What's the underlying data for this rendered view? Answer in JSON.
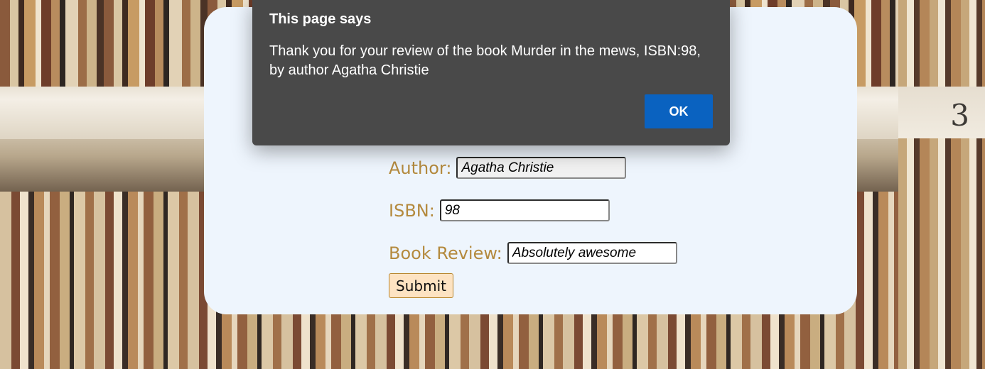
{
  "background": {
    "shelf_number": "3"
  },
  "form": {
    "author_label": "Author:",
    "author_value": "Agatha Christie",
    "isbn_label": "ISBN:",
    "isbn_value": "98",
    "review_label": "Book Review:",
    "review_value": "Absolutely awesome",
    "submit_label": "Submit"
  },
  "dialog": {
    "title": "This page says",
    "message": "Thank you for your review of the book Murder in the mews, ISBN:98, by author Agatha Christie",
    "ok_label": "OK"
  },
  "colors": {
    "card_bg": "#eef5fd",
    "label_color": "#b48a3e",
    "dialog_bg": "#494949",
    "ok_button": "#0a62c0",
    "submit_bg": "#fde3c2"
  }
}
